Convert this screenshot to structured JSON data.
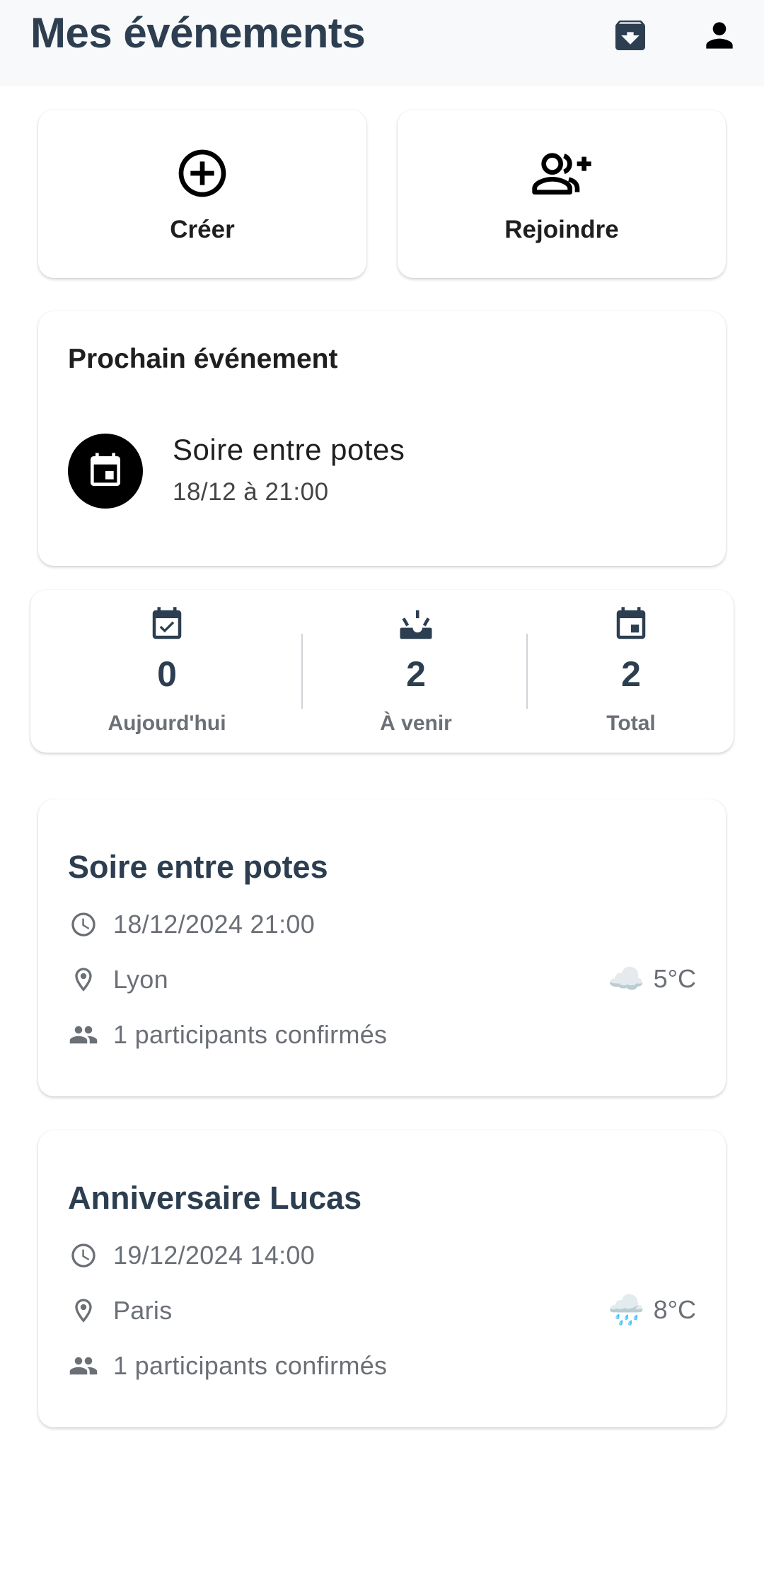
{
  "app": {
    "title": "Mes événements",
    "icons": [
      "archive-icon",
      "person-icon"
    ]
  },
  "actions": [
    {
      "label": "Créer",
      "icon": "add-circle-icon"
    },
    {
      "label": "Rejoindre",
      "icon": "group-add-icon"
    }
  ],
  "next_event": {
    "heading": "Prochain événement",
    "name": "Soire entre potes",
    "date": "18/12 à 21:00",
    "icon": "event-icon"
  },
  "stats": [
    {
      "value": "0",
      "label": "Aujourd'hui",
      "icon": "event-available-icon"
    },
    {
      "value": "2",
      "label": "À venir",
      "icon": "upcoming-icon"
    },
    {
      "value": "2",
      "label": "Total",
      "icon": "event-icon"
    }
  ],
  "events": [
    {
      "title": "Soire entre potes",
      "datetime": "18/12/2024 21:00",
      "location": "Lyon",
      "participants": "1 participants confirmés",
      "weather_icon": "☁️",
      "temperature": "5°C"
    },
    {
      "title": "Anniversaire Lucas",
      "datetime": "19/12/2024 14:00",
      "location": "Paris",
      "participants": "1 participants confirmés",
      "weather_icon": "🌧️",
      "temperature": "8°C"
    }
  ],
  "colors": {
    "title": "#2c3e50",
    "secondary_text": "#6b6f76",
    "appbar_bg": "#f8f9fb"
  }
}
